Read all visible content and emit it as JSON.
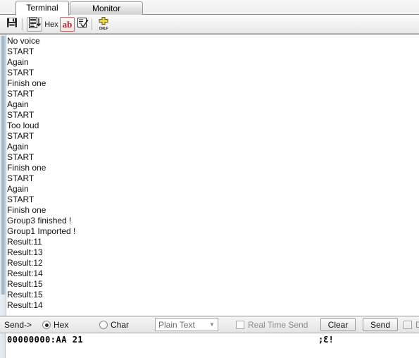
{
  "tabs": [
    {
      "label": "Terminal",
      "active": true
    },
    {
      "label": "Monitor",
      "active": false
    }
  ],
  "toolbar": {
    "save_icon": "floppy-disk-icon",
    "hexdump_icon": "hex-dump-icon",
    "hex_label": "Hex",
    "ab_label": "ab",
    "edit_icon": "edit-check-icon",
    "crlf_label": "CRLF"
  },
  "terminal": {
    "lines": [
      "No voice",
      "START",
      "Again",
      "START",
      "Finish one",
      "START",
      "Again",
      "START",
      "Too loud",
      "START",
      "Again",
      "START",
      "Finish one",
      "START",
      "Again",
      "START",
      "Finish one",
      "Group3 finished !",
      "Group1 Imported !",
      "Result:11",
      "Result:13",
      "Result:12",
      "Result:14",
      "Result:15",
      "Result:15",
      "Result:14"
    ]
  },
  "controls": {
    "send_label": "Send->",
    "hex_radio_label": "Hex",
    "char_radio_label": "Char",
    "hex_radio_checked": true,
    "char_radio_checked": false,
    "format_combo_value": "Plain Text",
    "realtime_label": "Real Time Send",
    "realtime_checked": false,
    "clear_button": "Clear",
    "send_button": "Send",
    "right_checkbox_label": "D",
    "right_checkbox_checked": false
  },
  "hex_input": {
    "offset": "00000000:",
    "bytes": "AA 21",
    "ascii": ";Ɛ!"
  },
  "colors": {
    "accent_red": "#a03030",
    "window_bg": "#f0f0f0",
    "text": "#111111",
    "scrollbar": "#97aec2"
  }
}
